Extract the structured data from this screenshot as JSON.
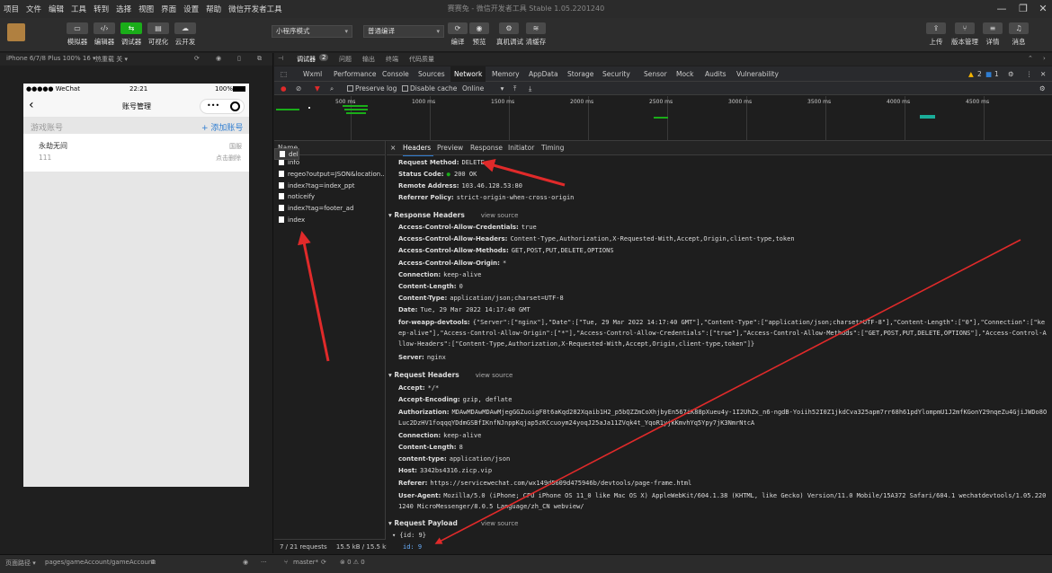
{
  "menubar": {
    "items": [
      "项目",
      "文件",
      "编辑",
      "工具",
      "转到",
      "选择",
      "视图",
      "界面",
      "设置",
      "帮助",
      "微信开发者工具"
    ]
  },
  "window": {
    "title": "赛赛兔 - 微信开发者工具 Stable 1.05.2201240"
  },
  "toolbar": {
    "left_buttons": [
      {
        "icon": "phone-icon",
        "label": "模拟器"
      },
      {
        "icon": "code-icon",
        "label": "编辑器"
      },
      {
        "icon": "debug-icon",
        "label": "调试器"
      },
      {
        "icon": "layout-icon",
        "label": "可视化"
      },
      {
        "icon": "cloud-icon",
        "label": "云开发"
      }
    ],
    "mode_select": "小程序模式",
    "compile_select": "普通编译",
    "compile_buttons": [
      {
        "icon": "refresh-icon",
        "label": "编译"
      },
      {
        "icon": "eye-icon",
        "label": "预览"
      },
      {
        "icon": "device-icon",
        "label": "真机调试"
      },
      {
        "icon": "layers-icon",
        "label": "清缓存"
      }
    ],
    "right_buttons": [
      {
        "icon": "upload-icon",
        "label": "上传"
      },
      {
        "icon": "branch-icon",
        "label": "版本管理"
      },
      {
        "icon": "menu-icon",
        "label": "详情"
      },
      {
        "icon": "bell-icon",
        "label": "消息"
      }
    ]
  },
  "simulator": {
    "device": "iPhone 6/7/8 Plus 100% 16 ▾",
    "hotreload": "热重载 关 ▾",
    "status": {
      "carrier": "●●●●● WeChat",
      "time": "22:21",
      "battery": "100%"
    },
    "nav_title": "账号管理",
    "section_label": "游戏账号",
    "add_label": "+ 添加账号",
    "account": {
      "name": "永劫无间",
      "id": "111",
      "server": "国服",
      "delete_hint": "点击删除"
    }
  },
  "devtools": {
    "top_tabs": [
      "调试器",
      "2",
      "问题",
      "输出",
      "终端",
      "代码质量"
    ],
    "panel_tabs": [
      "Wxml",
      "Performance",
      "Console",
      "Sources",
      "Network",
      "Memory",
      "AppData",
      "Storage",
      "Security",
      "Sensor",
      "Mock",
      "Audits",
      "Vulnerability"
    ],
    "active_panel": "Network",
    "warn_count": "2",
    "info_count": "1",
    "network_toolbar": {
      "preserve_log": "Preserve log",
      "disable_cache": "Disable cache",
      "throttle": "Online"
    },
    "timeline_ticks": [
      "500 ms",
      "1000 ms",
      "1500 ms",
      "2000 ms",
      "2500 ms",
      "3000 ms",
      "3500 ms",
      "4000 ms",
      "4500 ms"
    ],
    "requests_header": "Name",
    "requests": [
      "info",
      "regeo?output=JSON&location...",
      "index?tag=index_ppt",
      "noticeify",
      "index?tag=footer_ad",
      "index",
      "del"
    ],
    "selected_request": "del",
    "footer": {
      "count": "7 / 21 requests",
      "size": "15.5 kB / 15.5 kB"
    },
    "detail_tabs": [
      "Headers",
      "Preview",
      "Response",
      "Initiator",
      "Timing"
    ],
    "active_detail_tab": "Headers",
    "general": [
      {
        "k": "Request Method:",
        "v": "DELETE"
      },
      {
        "k": "Status Code:",
        "v": "200 OK"
      },
      {
        "k": "Remote Address:",
        "v": "103.46.128.53:80"
      },
      {
        "k": "Referrer Policy:",
        "v": "strict-origin-when-cross-origin"
      }
    ],
    "response_headers_title": "Response Headers",
    "view_source": "view source",
    "response_headers": [
      {
        "k": "Access-Control-Allow-Credentials:",
        "v": "true"
      },
      {
        "k": "Access-Control-Allow-Headers:",
        "v": "Content-Type,Authorization,X-Requested-With,Accept,Origin,client-type,token"
      },
      {
        "k": "Access-Control-Allow-Methods:",
        "v": "GET,POST,PUT,DELETE,OPTIONS"
      },
      {
        "k": "Access-Control-Allow-Origin:",
        "v": "*"
      },
      {
        "k": "Connection:",
        "v": "keep-alive"
      },
      {
        "k": "Content-Length:",
        "v": "0"
      },
      {
        "k": "Content-Type:",
        "v": "application/json;charset=UTF-8"
      },
      {
        "k": "Date:",
        "v": "Tue, 29 Mar 2022 14:17:40 GMT"
      }
    ],
    "weapp_devtools_key": "for-weapp-devtools:",
    "weapp_devtools_val": "{\"Server\":[\"nginx\"],\"Date\":[\"Tue, 29 Mar 2022 14:17:40 GMT\"],\"Content-Type\":[\"application/json;charset=UTF-8\"],\"Content-Length\":[\"0\"],\"Connection\":[\"keep-alive\"],\"Access-Control-Allow-Origin\":[\"*\"],\"Access-Control-Allow-Credentials\":[\"true\"],\"Access-Control-Allow-Methods\":[\"GET,POST,PUT,DELETE,OPTIONS\"],\"Access-Control-Allow-Headers\":[\"Content-Type,Authorization,X-Requested-With,Accept,Origin,client-type,token\"]}",
    "server_kv": {
      "k": "Server:",
      "v": "nginx"
    },
    "request_headers_title": "Request Headers",
    "request_headers_a": [
      {
        "k": "Accept:",
        "v": "*/*"
      },
      {
        "k": "Accept-Encoding:",
        "v": "gzip, deflate"
      }
    ],
    "authorization_key": "Authorization:",
    "authorization_val": "MDAwMDAwMDAwMjegGGZuoigF8t6aKqd282Xqaib1H2_p5bQZZmCoXhjbyEn567iK88pXueu4y-1I2UhZx_n6-ngdB-Yoiih52I0Z1jkdCva325apm7rr68h61pdYlompmU1J2mfKGonY29nqeZu4GjiJWDo8OLuc2DzHV1foqqqYDdmGSBfIKnfNJnppKqjap5zKCcuoym24yoqJ25aJa11ZVqk4t_YqoR1yjkKmvhYq5Ypy7jK3NmrNtcA",
    "request_headers_b": [
      {
        "k": "Connection:",
        "v": "keep-alive"
      },
      {
        "k": "Content-Length:",
        "v": "8"
      },
      {
        "k": "content-type:",
        "v": "application/json"
      },
      {
        "k": "Host:",
        "v": "3342bs4316.zicp.vip"
      },
      {
        "k": "Referer:",
        "v": "https://servicewechat.com/wx149d5609d475946b/devtools/page-frame.html"
      }
    ],
    "user_agent_key": "User-Agent:",
    "user_agent_val": "Mozilla/5.0 (iPhone; CPU iPhone OS 11_0 like Mac OS X) AppleWebKit/604.1.38 (KHTML, like Gecko) Version/11.0 Mobile/15A372 Safari/604.1 wechatdevtools/1.05.2201240 MicroMessenger/8.0.5 Language/zh_CN webview/",
    "payload_title": "Request Payload",
    "payload_summary": "▾ {id: 9}",
    "payload_field": "id: 9"
  },
  "statusbar": {
    "page_path_label": "页面路径 ▾",
    "page_path": "pages/gameAccount/gameAccount",
    "branch": "master*",
    "errors": "⊗ 0 ⚠ 0"
  },
  "colors": {
    "accent_green": "#1aad19",
    "annotation_red": "#e02a2a",
    "link_blue": "#2f7dd1"
  }
}
